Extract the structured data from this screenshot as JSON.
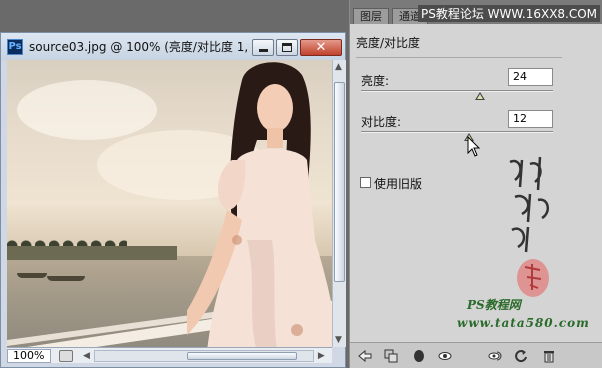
{
  "document": {
    "title": "source03.jpg @ 100% (亮度/对比度 1, ...",
    "app_icon": "Ps",
    "close_glyph": "✕",
    "zoom": "100%"
  },
  "panel": {
    "tabs": [
      "图层",
      "通道"
    ],
    "watermark_top": "PS教程论坛 WWW.16XX8.COM",
    "title": "亮度/对比度",
    "brightness": {
      "label": "亮度:",
      "value": "24",
      "slider_fraction": 0.62
    },
    "contrast": {
      "label": "对比度:",
      "value": "12",
      "slider_fraction": 0.56
    },
    "legacy": {
      "label": "使用旧版",
      "checked": false
    },
    "watermark_ps": "PS教程网",
    "watermark_url": "www.tata580.com"
  },
  "icons": {
    "toolbar": [
      "back-arrow-icon",
      "clip-layer-icon",
      "visibility-toggle-icon",
      "eye-icon",
      "view-previous-icon",
      "reset-icon",
      "trash-icon"
    ]
  }
}
